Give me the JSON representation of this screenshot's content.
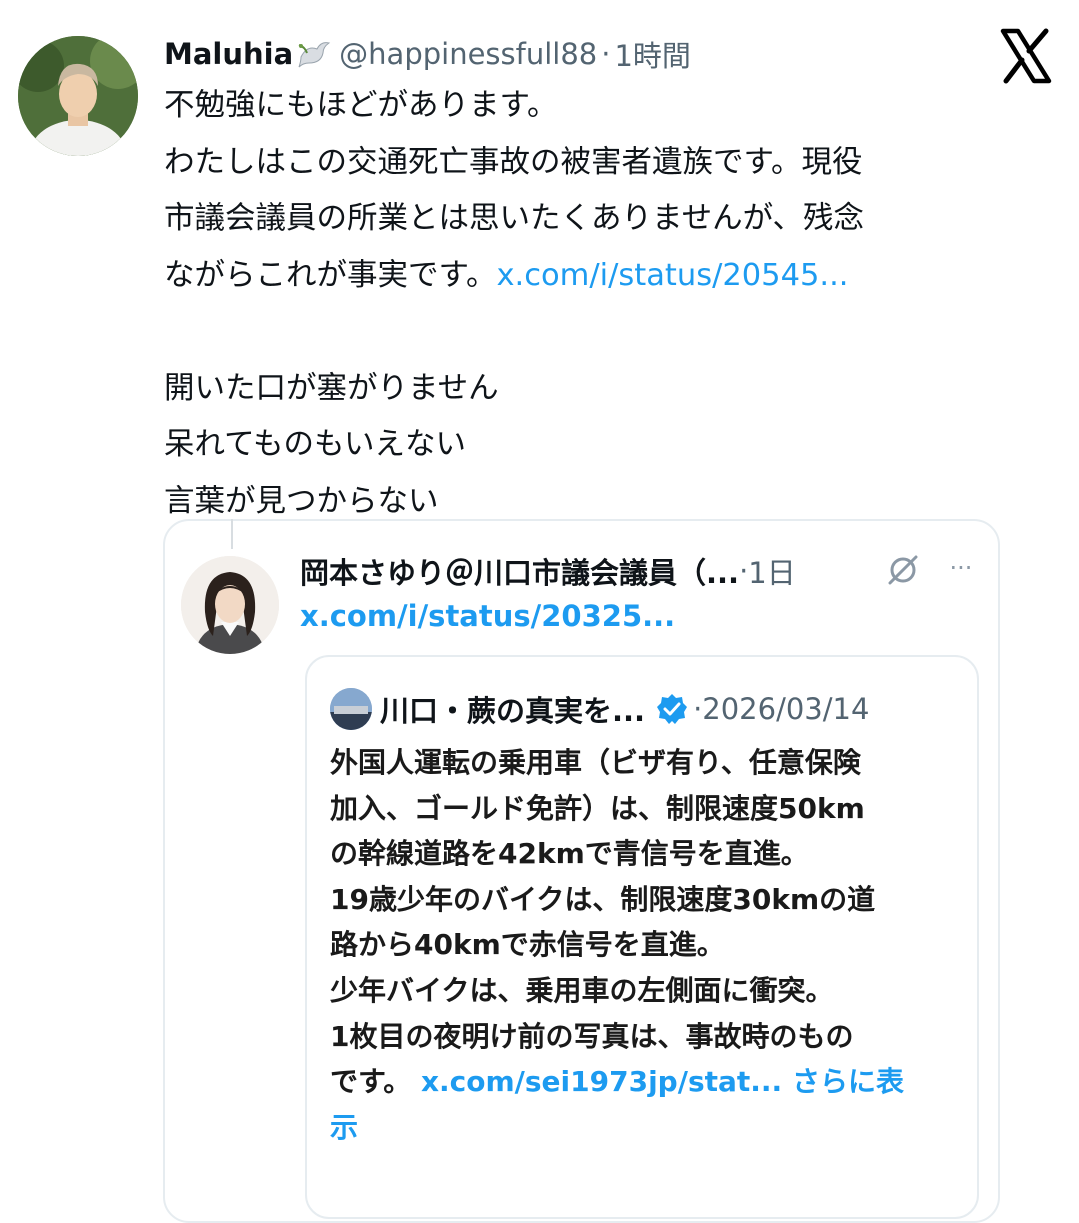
{
  "tweet": {
    "author_name": "Maluhia",
    "handle": "@happinessfull88",
    "separator": "·",
    "time": "1時間",
    "lines": [
      "不勉強にもほどがあります。",
      "わたしはこの交通死亡事故の被害者遺族です。現役",
      "市議会議員の所業とは思いたくありませんが、残念"
    ],
    "line4_text": "ながらこれが事実です。",
    "line4_link": "x.com/i/status/20545...",
    "lines2": [
      "開いた口が塞がりません",
      "呆れてものもいえない",
      "言葉が見つからない"
    ]
  },
  "quote": {
    "author": "岡本さゆり＠川口市議会議員（...",
    "separator": "·",
    "time": "1日",
    "link": "x.com/i/status/20325...",
    "more": "···"
  },
  "inner_quote": {
    "author": "川口・蕨の真実を...",
    "separator": "·",
    "date": "2026/03/14",
    "lines": [
      "外国人運転の乗用車（ビザ有り、任意保険",
      "加入、ゴールド免許）は、制限速度50km",
      "の幹線道路を42kmで青信号を直進。",
      "19歳少年のバイクは、制限速度30kmの道",
      "路から40kmで赤信号を直進。",
      "少年バイクは、乗用車の左側面に衝突。",
      "1枚目の夜明け前の写真は、事故時のもの"
    ],
    "last_text": "です。",
    "last_link": "x.com/sei1973jp/stat...",
    "show_more_1": "さらに表",
    "show_more_2": "示"
  },
  "colors": {
    "link": "#1d9bf0",
    "secondary_text": "#536471",
    "border": "#e6ecf0"
  },
  "icons": [
    "x-logo-icon",
    "dove-icon",
    "verified-badge-icon",
    "grok-icon",
    "more-icon"
  ]
}
